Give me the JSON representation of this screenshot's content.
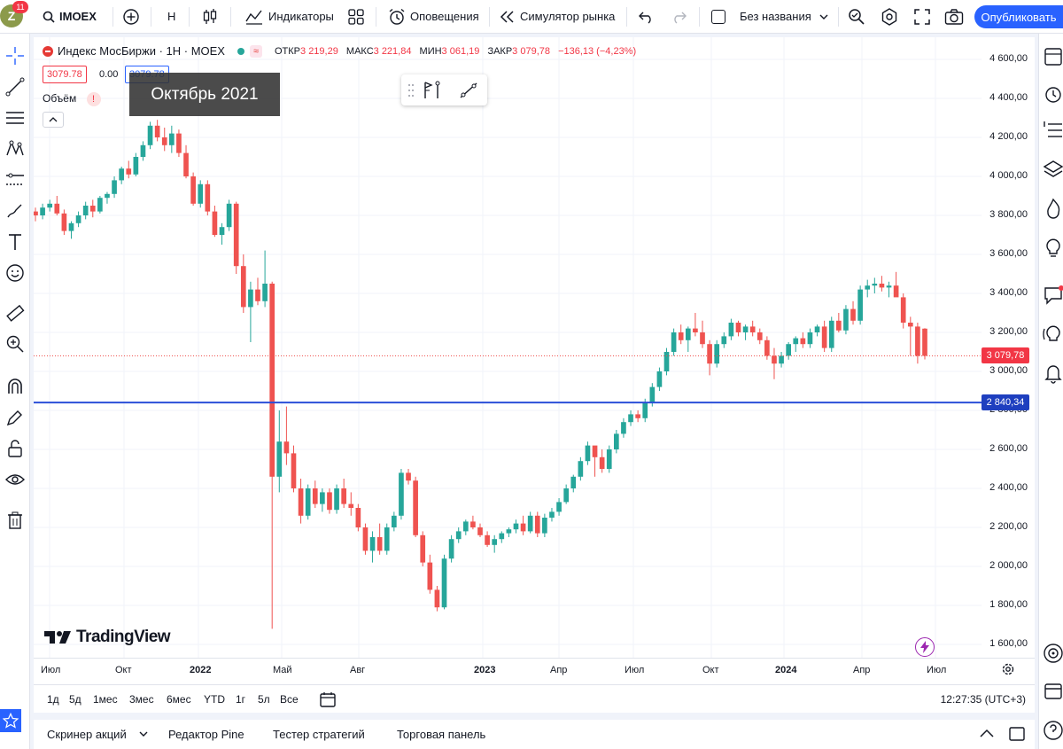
{
  "topbar": {
    "avatar_letter": "Z",
    "badge": "11",
    "symbol": "IMOEX",
    "interval": "H",
    "indicators": "Индикаторы",
    "alerts": "Оповещения",
    "replay": "Симулятор рынка",
    "layout_name": "Без названия",
    "publish": "Опубликовать"
  },
  "legend": {
    "title": "Индекс МосБиржи · 1Н · MOEX",
    "open_label": "ОТКР",
    "open": "3 219,29",
    "high_label": "МАКС",
    "high": "3 221,84",
    "low_label": "МИН",
    "low": "3 061,19",
    "close_label": "ЗАКР",
    "close": "3 079,78",
    "change": "−136,13 (−4,23%)",
    "sell": "3079.78",
    "spread": "0.00",
    "buy": "3079.78",
    "volume_label": "Объём",
    "volume_warn": "!"
  },
  "tooltip": "Октябрь 2021",
  "yaxis": {
    "ticks": [
      "4 600,00",
      "4 400,00",
      "4 200,00",
      "4 000,00",
      "3 800,00",
      "3 600,00",
      "3 400,00",
      "3 200,00",
      "3 000,00",
      "2 800,00",
      "2 600,00",
      "2 400,00",
      "2 200,00",
      "2 000,00",
      "1 800,00",
      "1 600,00"
    ],
    "last_price": "3 079,78",
    "hline_price": "2 840,34"
  },
  "xaxis": {
    "ticks": [
      "Июл",
      "Окт",
      "2022",
      "Май",
      "Авг",
      "2023",
      "Апр",
      "Июл",
      "Окт",
      "2024",
      "Апр",
      "Июл"
    ]
  },
  "chart_data": {
    "type": "candlestick",
    "symbol": "IMOEX",
    "interval": "1Н",
    "ylim": [
      1500,
      4700
    ],
    "hline": 2840.34,
    "last": 3079.78,
    "candles": [
      [
        3820,
        3840,
        3770,
        3800
      ],
      [
        3800,
        3860,
        3780,
        3840
      ],
      [
        3840,
        3880,
        3820,
        3860
      ],
      [
        3860,
        3900,
        3800,
        3810
      ],
      [
        3810,
        3830,
        3700,
        3720
      ],
      [
        3720,
        3770,
        3680,
        3760
      ],
      [
        3760,
        3820,
        3740,
        3800
      ],
      [
        3800,
        3870,
        3780,
        3850
      ],
      [
        3850,
        3880,
        3790,
        3820
      ],
      [
        3820,
        3900,
        3810,
        3890
      ],
      [
        3890,
        3920,
        3860,
        3910
      ],
      [
        3910,
        4000,
        3890,
        3980
      ],
      [
        3980,
        4050,
        3960,
        4040
      ],
      [
        4040,
        4080,
        3990,
        4010
      ],
      [
        4010,
        4120,
        4000,
        4100
      ],
      [
        4100,
        4180,
        4080,
        4160
      ],
      [
        4160,
        4280,
        4140,
        4260
      ],
      [
        4260,
        4290,
        4180,
        4200
      ],
      [
        4200,
        4250,
        4130,
        4160
      ],
      [
        4160,
        4260,
        4120,
        4220
      ],
      [
        4220,
        4240,
        4100,
        4120
      ],
      [
        4120,
        4160,
        3990,
        4000
      ],
      [
        4000,
        4020,
        3850,
        3860
      ],
      [
        3860,
        3980,
        3840,
        3960
      ],
      [
        3960,
        3980,
        3800,
        3820
      ],
      [
        3820,
        3850,
        3690,
        3700
      ],
      [
        3700,
        3760,
        3650,
        3740
      ],
      [
        3740,
        3880,
        3720,
        3860
      ],
      [
        3860,
        3870,
        3500,
        3540
      ],
      [
        3540,
        3600,
        3300,
        3330
      ],
      [
        3330,
        3460,
        3150,
        3420
      ],
      [
        3420,
        3480,
        3340,
        3360
      ],
      [
        3360,
        3620,
        3330,
        3450
      ],
      [
        3450,
        3460,
        1680,
        2460
      ],
      [
        2460,
        2800,
        2380,
        2640
      ],
      [
        2640,
        2820,
        2520,
        2580
      ],
      [
        2580,
        2620,
        2380,
        2400
      ],
      [
        2400,
        2450,
        2220,
        2260
      ],
      [
        2260,
        2420,
        2240,
        2400
      ],
      [
        2400,
        2440,
        2300,
        2320
      ],
      [
        2320,
        2400,
        2280,
        2380
      ],
      [
        2380,
        2400,
        2270,
        2290
      ],
      [
        2290,
        2420,
        2270,
        2400
      ],
      [
        2400,
        2450,
        2300,
        2320
      ],
      [
        2320,
        2380,
        2260,
        2300
      ],
      [
        2300,
        2320,
        2180,
        2200
      ],
      [
        2200,
        2220,
        2060,
        2080
      ],
      [
        2080,
        2180,
        2020,
        2150
      ],
      [
        2150,
        2220,
        2060,
        2080
      ],
      [
        2080,
        2220,
        2060,
        2200
      ],
      [
        2200,
        2280,
        2180,
        2260
      ],
      [
        2260,
        2500,
        2240,
        2480
      ],
      [
        2480,
        2500,
        2420,
        2440
      ],
      [
        2440,
        2460,
        2150,
        2160
      ],
      [
        2160,
        2180,
        2000,
        2020
      ],
      [
        2020,
        2060,
        1860,
        1880
      ],
      [
        1880,
        1900,
        1770,
        1790
      ],
      [
        1790,
        2060,
        1780,
        2040
      ],
      [
        2040,
        2160,
        2020,
        2140
      ],
      [
        2140,
        2200,
        2120,
        2180
      ],
      [
        2180,
        2240,
        2160,
        2230
      ],
      [
        2230,
        2260,
        2190,
        2200
      ],
      [
        2200,
        2220,
        2150,
        2160
      ],
      [
        2160,
        2180,
        2100,
        2110
      ],
      [
        2110,
        2160,
        2070,
        2140
      ],
      [
        2140,
        2180,
        2120,
        2170
      ],
      [
        2170,
        2200,
        2150,
        2190
      ],
      [
        2190,
        2240,
        2170,
        2220
      ],
      [
        2220,
        2260,
        2160,
        2180
      ],
      [
        2180,
        2280,
        2170,
        2260
      ],
      [
        2260,
        2280,
        2150,
        2170
      ],
      [
        2170,
        2270,
        2150,
        2250
      ],
      [
        2250,
        2300,
        2230,
        2280
      ],
      [
        2280,
        2350,
        2260,
        2330
      ],
      [
        2330,
        2420,
        2320,
        2400
      ],
      [
        2400,
        2470,
        2380,
        2460
      ],
      [
        2460,
        2560,
        2440,
        2540
      ],
      [
        2540,
        2640,
        2520,
        2620
      ],
      [
        2620,
        2580,
        2460,
        2560
      ],
      [
        2560,
        2600,
        2480,
        2500
      ],
      [
        2500,
        2620,
        2480,
        2600
      ],
      [
        2600,
        2700,
        2580,
        2680
      ],
      [
        2680,
        2760,
        2660,
        2740
      ],
      [
        2740,
        2800,
        2720,
        2780
      ],
      [
        2780,
        2800,
        2740,
        2760
      ],
      [
        2760,
        2860,
        2740,
        2840
      ],
      [
        2840,
        2940,
        2820,
        2920
      ],
      [
        2920,
        3020,
        2900,
        3000
      ],
      [
        3000,
        3120,
        2980,
        3100
      ],
      [
        3100,
        3220,
        3080,
        3200
      ],
      [
        3200,
        3240,
        3140,
        3160
      ],
      [
        3160,
        3230,
        3100,
        3220
      ],
      [
        3220,
        3300,
        3180,
        3200
      ],
      [
        3200,
        3260,
        3120,
        3140
      ],
      [
        3140,
        3160,
        2980,
        3040
      ],
      [
        3040,
        3160,
        3020,
        3140
      ],
      [
        3140,
        3200,
        3120,
        3180
      ],
      [
        3180,
        3270,
        3160,
        3250
      ],
      [
        3250,
        3260,
        3180,
        3200
      ],
      [
        3200,
        3240,
        3160,
        3230
      ],
      [
        3230,
        3260,
        3180,
        3200
      ],
      [
        3200,
        3220,
        3140,
        3160
      ],
      [
        3160,
        3180,
        3060,
        3080
      ],
      [
        3080,
        3120,
        2960,
        3040
      ],
      [
        3040,
        3100,
        3020,
        3080
      ],
      [
        3080,
        3150,
        3060,
        3140
      ],
      [
        3140,
        3180,
        3100,
        3170
      ],
      [
        3170,
        3200,
        3120,
        3140
      ],
      [
        3140,
        3220,
        3120,
        3200
      ],
      [
        3200,
        3240,
        3180,
        3230
      ],
      [
        3230,
        3260,
        3100,
        3120
      ],
      [
        3120,
        3280,
        3100,
        3260
      ],
      [
        3260,
        3300,
        3200,
        3210
      ],
      [
        3210,
        3340,
        3190,
        3320
      ],
      [
        3320,
        3360,
        3240,
        3260
      ],
      [
        3260,
        3440,
        3240,
        3420
      ],
      [
        3420,
        3470,
        3380,
        3440
      ],
      [
        3440,
        3480,
        3400,
        3450
      ],
      [
        3450,
        3490,
        3410,
        3430
      ],
      [
        3430,
        3460,
        3380,
        3440
      ],
      [
        3440,
        3510,
        3420,
        3380
      ],
      [
        3380,
        3400,
        3220,
        3250
      ],
      [
        3250,
        3280,
        3080,
        3230
      ],
      [
        3230,
        3250,
        3040,
        3080
      ],
      [
        3219.29,
        3221.84,
        3061.19,
        3079.78
      ]
    ]
  },
  "range": {
    "buttons": [
      "1д",
      "5д",
      "1мес",
      "3мес",
      "6мес",
      "YTD",
      "1г",
      "5л",
      "Все"
    ],
    "time": "12:27:35 (UTC+3)"
  },
  "bottom": {
    "tabs": [
      "Скринер акций",
      "Редактор Pine",
      "Тестер стратегий",
      "Торговая панель"
    ]
  },
  "colors": {
    "up": "#26a69a",
    "down": "#ef5350",
    "hline": "#2b4fd8",
    "accent": "#2962ff"
  }
}
